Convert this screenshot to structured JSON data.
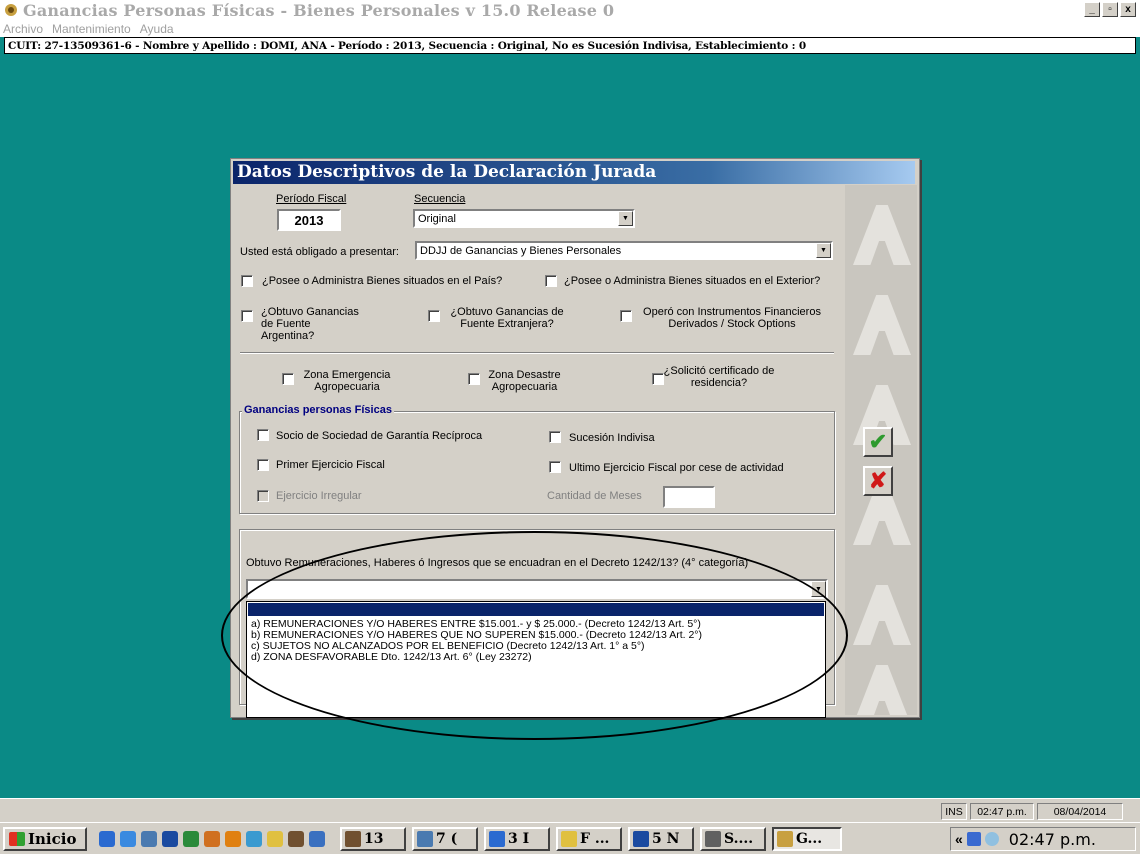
{
  "window": {
    "title": "Ganancias Personas Físicas - Bienes Personales v 15.0 Release 0",
    "controls": [
      "_",
      "▫",
      "x"
    ]
  },
  "menu": [
    "Archivo",
    "Mantenimiento",
    "Ayuda"
  ],
  "info_bar": "CUIT: 27-13509361-6 - Nombre y Apellido : DOMI, ANA - Período : 2013, Secuencia : Original, No es Sucesión Indivisa, Establecimiento : 0",
  "dialog": {
    "title": "Datos Descriptivos de la Declaración Jurada",
    "periodo_label": "Período Fiscal",
    "periodo_value": "2013",
    "secuencia_label": "Secuencia",
    "secuencia_value": "Original",
    "obligado_label": "Usted está obligado a presentar:",
    "obligado_value": "DDJJ de Ganancias y Bienes Personales",
    "cb_bienes_pais": "¿Posee o Administra Bienes situados en el País?",
    "cb_bienes_exterior": "¿Posee o Administra Bienes situados en el Exterior?",
    "cb_gan_arg": "¿Obtuvo Ganancias de Fuente Argentina?",
    "cb_gan_ext": "¿Obtuvo Ganancias de Fuente Extranjera?",
    "cb_instrumentos": "Operó con Instrumentos Financieros Derivados / Stock Options",
    "cb_zona_emergencia": "Zona Emergencia Agropecuaria",
    "cb_zona_desastre": "Zona Desastre Agropecuaria",
    "cb_certificado": "¿Solicitó certificado de residencia?",
    "group_title": "Ganancias personas Físicas",
    "cb_socio": "Socio de Sociedad de Garantía Recíproca",
    "cb_sucesion": "Sucesión Indivisa",
    "cb_primer": "Primer Ejercicio Fiscal",
    "cb_ultimo": "Ultimo Ejercicio Fiscal por cese de actividad",
    "cb_irregular": "Ejercicio Irregular",
    "meses_label": "Cantidad de Meses",
    "remuneraciones_question": "Obtuvo Remuneraciones, Haberes ó Ingresos que se encuadran en el Decreto 1242/13? (4° categoría)",
    "remuneraciones_value": "",
    "ok_icon": "checkmark-icon",
    "cancel_icon": "x-icon"
  },
  "dropdown_options": [
    "",
    "a) REMUNERACIONES Y/O HABERES ENTRE $15.001.- y $ 25.000.- (Decreto 1242/13 Art. 5°)",
    "b) REMUNERACIONES Y/O HABERES QUE NO SUPEREN $15.000.- (Decreto 1242/13 Art. 2°)",
    "c) SUJETOS NO ALCANZADOS POR EL BENEFICIO (Decreto 1242/13 Art. 1° a 5°)",
    "d) ZONA DESFAVORABLE Dto. 1242/13 Art. 6° (Ley 23272)"
  ],
  "status": {
    "ins": "INS",
    "time": "02:47 p.m.",
    "date": "08/04/2014"
  },
  "taskbar": {
    "start": "Inicio",
    "buttons": [
      "13",
      "7 (",
      "3 I",
      "F ...",
      "5 N",
      "S....",
      "G..."
    ],
    "tray_arrow": "«",
    "clock": "02:47 p.m."
  },
  "colors": {
    "desktop": "#0a8a86",
    "dialog_title": "#0a246a",
    "group_title": "#000080",
    "ok_green": "#2e9a2e",
    "cancel_red": "#d01818"
  }
}
